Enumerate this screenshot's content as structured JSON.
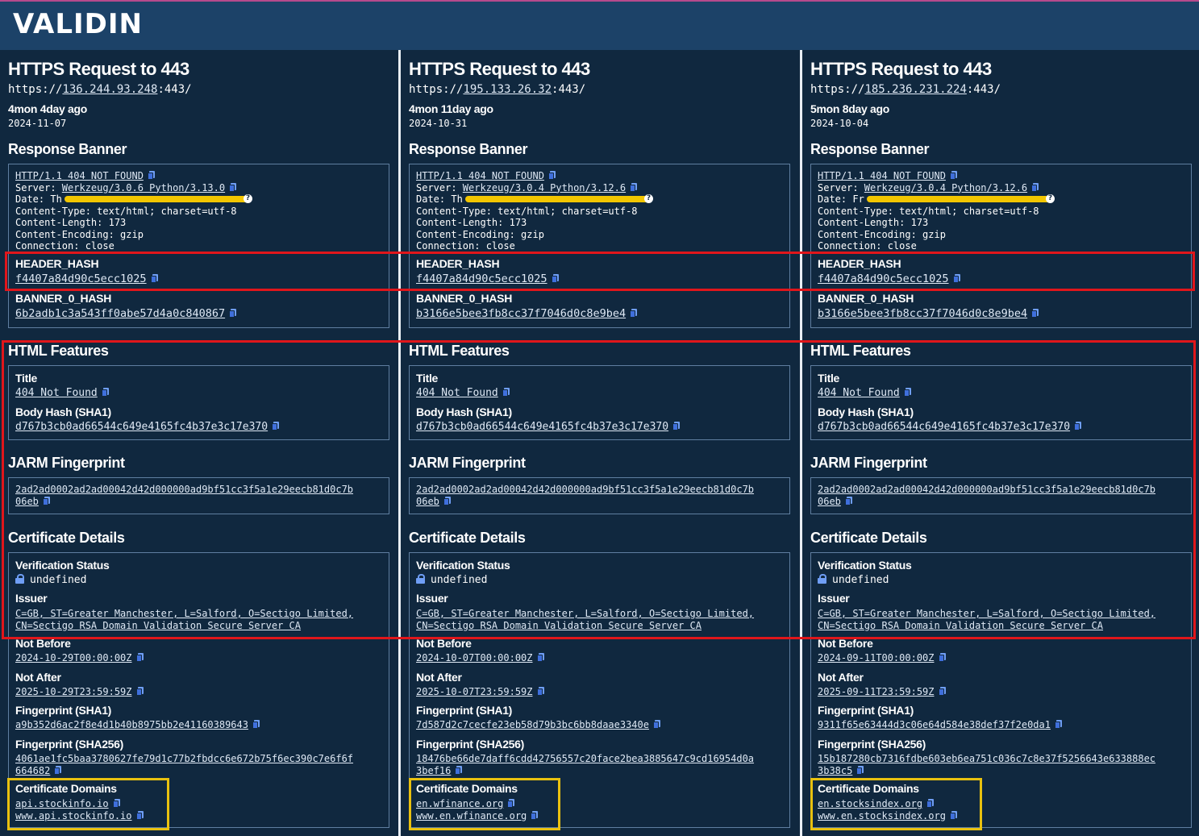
{
  "app": {
    "logo": "VALIDIN"
  },
  "labels": {
    "request_title": "HTTPS Request to 443",
    "url_prefix": "https://",
    "url_suffix": ":443/",
    "response_banner": "Response Banner",
    "header_hash": "HEADER_HASH",
    "banner_0_hash": "BANNER_0_HASH",
    "html_features": "HTML Features",
    "title": "Title",
    "body_hash": "Body Hash (SHA1)",
    "jarm": "JARM Fingerprint",
    "cert_details": "Certificate Details",
    "verification_status": "Verification Status",
    "issuer": "Issuer",
    "not_before": "Not Before",
    "not_after": "Not After",
    "fp_sha1": "Fingerprint (SHA1)",
    "fp_sha256": "Fingerprint (SHA256)",
    "cert_domains": "Certificate Domains"
  },
  "columns": [
    {
      "ip": "136.244.93.248",
      "ago": "4mon 4day ago",
      "date": "2024-11-07",
      "banner": {
        "status_line": "HTTP/1.1 404 NOT FOUND",
        "server_key": "Server: ",
        "server_val": "Werkzeug/3.0.6 Python/3.13.0",
        "date_line": "Date: Th",
        "content_type": "Content-Type: text/html; charset=utf-8",
        "content_length": "Content-Length: 173",
        "content_encoding": "Content-Encoding: gzip",
        "connection": "Connection: close"
      },
      "header_hash": "f4407a84d90c5ecc1025",
      "banner_0_hash": "6b2adb1c3a543ff0abe57d4a0c840867",
      "title": "404 Not Found",
      "body_hash": "d767b3cb0ad66544c649e4165fc4b37e3c17e370",
      "jarm_1": "2ad2ad0002ad2ad00042d42d000000ad9bf51cc3f5a1e29eecb81d0c7b",
      "jarm_2": "06eb",
      "verification": "undefined",
      "issuer_1": "C=GB, ST=Greater Manchester, L=Salford, O=Sectigo Limited,",
      "issuer_2": "CN=Sectigo RSA Domain Validation Secure Server CA",
      "not_before": "2024-10-29T00:00:00Z",
      "not_after": "2025-10-29T23:59:59Z",
      "fp_sha1": "a9b352d6ac2f8e4d1b40b8975bb2e41160389643",
      "fp_sha256_1": "4061ae1fc5baa3780627fe79d1c77b2fbdcc6e672b75f6ec390c7e6f6f",
      "fp_sha256_2": "664682",
      "domain_1": "api.stockinfo.io",
      "domain_2": "www.api.stockinfo.io"
    },
    {
      "ip": "195.133.26.32",
      "ago": "4mon 11day ago",
      "date": "2024-10-31",
      "banner": {
        "status_line": "HTTP/1.1 404 NOT FOUND",
        "server_key": "Server: ",
        "server_val": "Werkzeug/3.0.4 Python/3.12.6",
        "date_line": "Date: Th",
        "content_type": "Content-Type: text/html; charset=utf-8",
        "content_length": "Content-Length: 173",
        "content_encoding": "Content-Encoding: gzip",
        "connection": "Connection: close"
      },
      "header_hash": "f4407a84d90c5ecc1025",
      "banner_0_hash": "b3166e5bee3fb8cc37f7046d0c8e9be4",
      "title": "404 Not Found",
      "body_hash": "d767b3cb0ad66544c649e4165fc4b37e3c17e370",
      "jarm_1": "2ad2ad0002ad2ad00042d42d000000ad9bf51cc3f5a1e29eecb81d0c7b",
      "jarm_2": "06eb",
      "verification": "undefined",
      "issuer_1": "C=GB, ST=Greater Manchester, L=Salford, O=Sectigo Limited,",
      "issuer_2": "CN=Sectigo RSA Domain Validation Secure Server CA",
      "not_before": "2024-10-07T00:00:00Z",
      "not_after": "2025-10-07T23:59:59Z",
      "fp_sha1": "7d587d2c7cecfe23eb58d79b3bc6bb8daae3340e",
      "fp_sha256_1": "18476be66de7daff6cdd42756557c20face2bea3885647c9cd16954d0a",
      "fp_sha256_2": "3bef16",
      "domain_1": "en.wfinance.org",
      "domain_2": "www.en.wfinance.org"
    },
    {
      "ip": "185.236.231.224",
      "ago": "5mon 8day ago",
      "date": "2024-10-04",
      "banner": {
        "status_line": "HTTP/1.1 404 NOT FOUND",
        "server_key": "Server: ",
        "server_val": "Werkzeug/3.0.4 Python/3.12.6",
        "date_line": "Date: Fr",
        "content_type": "Content-Type: text/html; charset=utf-8",
        "content_length": "Content-Length: 173",
        "content_encoding": "Content-Encoding: gzip",
        "connection": "Connection: close"
      },
      "header_hash": "f4407a84d90c5ecc1025",
      "banner_0_hash": "b3166e5bee3fb8cc37f7046d0c8e9be4",
      "title": "404 Not Found",
      "body_hash": "d767b3cb0ad66544c649e4165fc4b37e3c17e370",
      "jarm_1": "2ad2ad0002ad2ad00042d42d000000ad9bf51cc3f5a1e29eecb81d0c7b",
      "jarm_2": "06eb",
      "verification": "undefined",
      "issuer_1": "C=GB, ST=Greater Manchester, L=Salford, O=Sectigo Limited,",
      "issuer_2": "CN=Sectigo RSA Domain Validation Secure Server CA",
      "not_before": "2024-09-11T00:00:00Z",
      "not_after": "2025-09-11T23:59:59Z",
      "fp_sha1": "9311f65e63444d3c06e64d584e38def37f2e0da1",
      "fp_sha256_1": "15b187280cb7316fdbe603eb6ea751c036c7c8e37f5256643e633888ec",
      "fp_sha256_2": "3b38c5",
      "domain_1": "en.stocksindex.org",
      "domain_2": "www.en.stocksindex.org"
    }
  ],
  "colors": {
    "background": "#0f2740",
    "topbar": "#1c4268",
    "highlight_red": "#e0161b",
    "highlight_yellow": "#e9c10f",
    "redaction": "#f2c600"
  },
  "icons": {
    "copy": "copy-icon",
    "lock": "lock-icon",
    "question": "question-icon"
  }
}
